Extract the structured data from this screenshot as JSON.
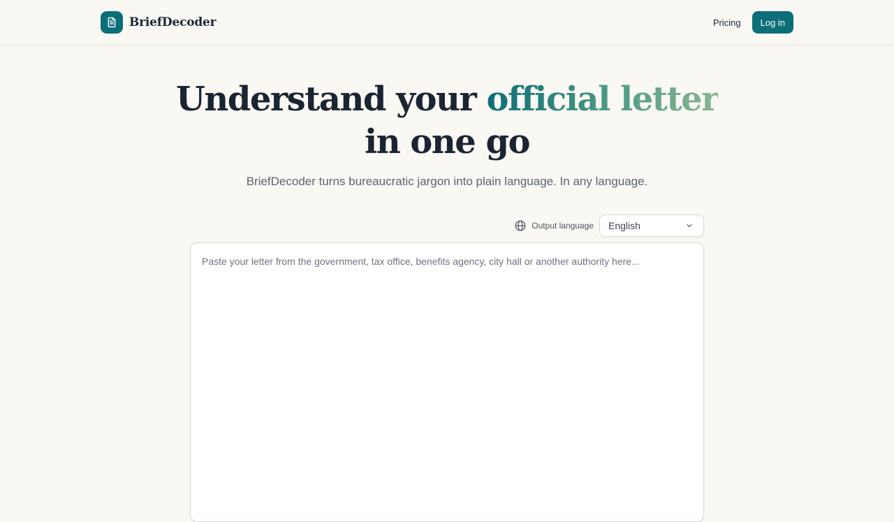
{
  "brand": {
    "name": "BriefDecoder",
    "logo_icon": "document-icon"
  },
  "nav": {
    "pricing": "Pricing",
    "login": "Log in"
  },
  "hero": {
    "title_before": "Understand your ",
    "title_accent": "official letter",
    "title_after": " in one go",
    "subtitle": "BriefDecoder turns bureaucratic jargon into plain language. In any language."
  },
  "language": {
    "icon": "globe-icon",
    "label": "Output language",
    "selected": "English"
  },
  "letter": {
    "placeholder": "Paste your letter from the government, tax office, benefits agency, city hall or another authority here...",
    "value": ""
  },
  "colors": {
    "brand": "#0b6e78",
    "background": "#faf8f3",
    "text": "#1a2433",
    "accent_gradient": [
      "#0b6e78",
      "#4f9a85",
      "#8ab593"
    ]
  }
}
